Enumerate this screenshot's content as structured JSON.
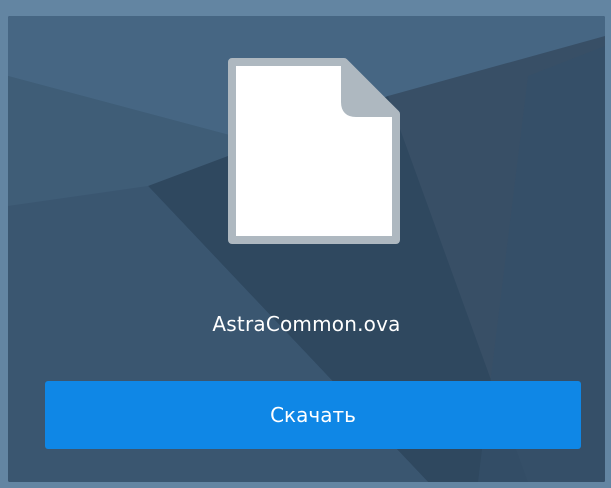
{
  "file": {
    "name": "AstraCommon.ova",
    "icon": "document-icon"
  },
  "actions": {
    "download_label": "Скачать"
  },
  "colors": {
    "page_background": "#6385a2",
    "card_background": "#3d5a74",
    "button_background": "#0f87e6",
    "button_text": "#ffffff",
    "file_icon_fill": "#ffffff",
    "file_icon_border": "#aab4bc"
  }
}
